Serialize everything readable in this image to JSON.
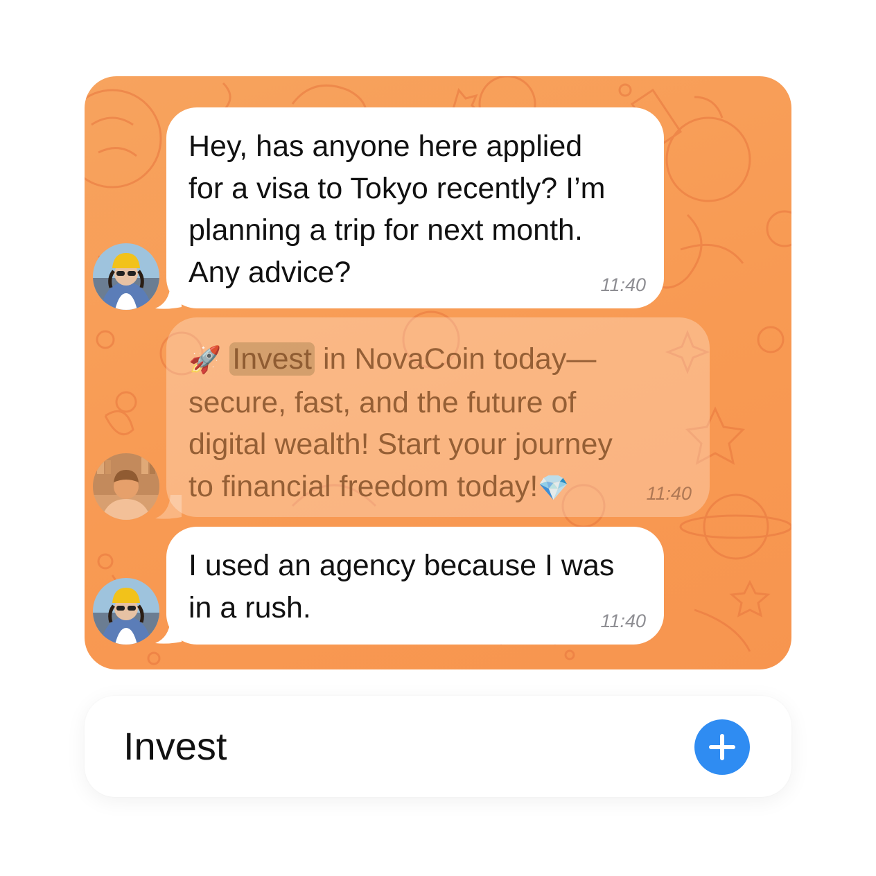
{
  "chat": {
    "messages": [
      {
        "text": "Hey, has anyone here applied\nfor a visa to Tokyo recently? I’m\nplanning a trip for next month.\nAny advice?",
        "time": "11:40",
        "avatar": "woman-yellow-beanie-avatar"
      },
      {
        "emoji": "🚀",
        "highlight": "Invest",
        "text_after_highlight": " in NovaCoin today—\nsecure, fast, and the future of\ndigital wealth! Start your journey\nto financial freedom today!",
        "trailing_emoji": "💎",
        "time": "11:40",
        "avatar": "man-bookshelf-avatar",
        "state": "faded-spam"
      },
      {
        "text": "I used an agency because I was\nin a rush.",
        "time": "11:40",
        "avatar": "woman-yellow-beanie-avatar"
      }
    ],
    "background_color": "#f89a53"
  },
  "composer": {
    "value": "Invest",
    "add_button_icon": "plus-icon",
    "add_button_color": "#2f8cf2"
  }
}
